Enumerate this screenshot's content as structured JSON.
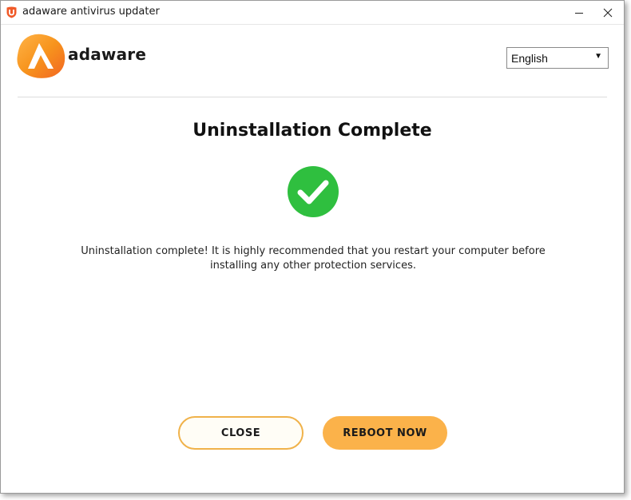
{
  "window": {
    "title": "adaware antivirus updater"
  },
  "header": {
    "brand": "adaware",
    "language": {
      "selected": "English",
      "arrow": "▼"
    }
  },
  "main": {
    "heading": "Uninstallation Complete",
    "message": "Uninstallation complete! It is highly recommended that you restart your computer before installing any other protection services.",
    "status_icon": "check-icon"
  },
  "buttons": {
    "close_label": "CLOSE",
    "reboot_label": "REBOOT NOW"
  },
  "colors": {
    "accent": "#fbb24a",
    "success": "#2fbf3f",
    "logo_orange": "#f7941d"
  }
}
